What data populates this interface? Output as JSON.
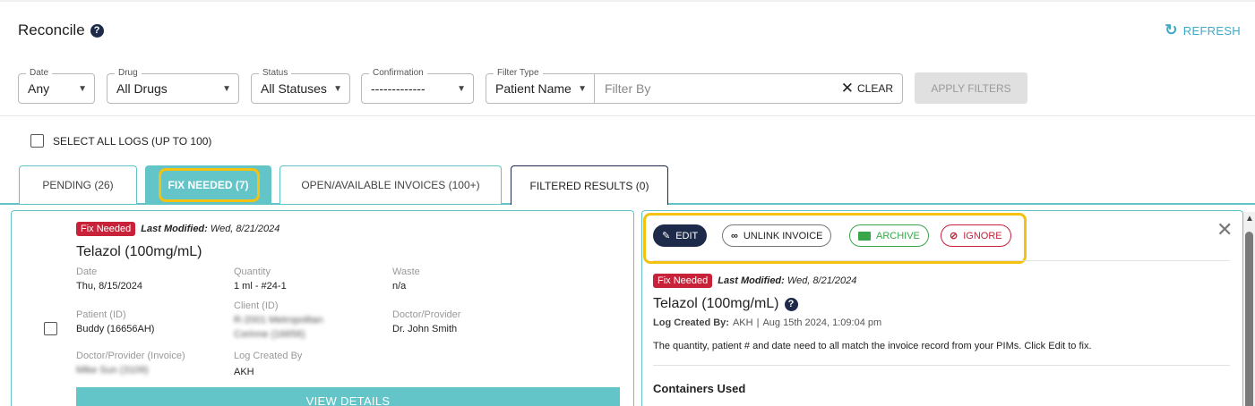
{
  "header": {
    "title": "Reconcile",
    "help_glyph": "?",
    "refresh_label": "REFRESH",
    "refresh_icon": "refresh-icon"
  },
  "filters": {
    "date": {
      "label": "Date",
      "value": "Any"
    },
    "drug": {
      "label": "Drug",
      "value": "All Drugs"
    },
    "status": {
      "label": "Status",
      "value": "All Statuses"
    },
    "confirmation": {
      "label": "Confirmation",
      "value": "-------------"
    },
    "filter_type": {
      "label": "Filter Type",
      "value": "Patient Name"
    },
    "filter_by_placeholder": "Filter By",
    "clear_label": "CLEAR",
    "apply_label": "APPLY FILTERS"
  },
  "select_all_label": "SELECT ALL LOGS (UP TO 100)",
  "tabs": [
    {
      "label": "PENDING (26)"
    },
    {
      "label": "FIX NEEDED (7)"
    },
    {
      "label": "OPEN/AVAILABLE INVOICES (100+)"
    },
    {
      "label": "FILTERED RESULTS (0)"
    }
  ],
  "log_card": {
    "badge": "Fix Needed",
    "modified_label": "Last Modified:",
    "modified_value": "Wed, 8/21/2024",
    "drug": "Telazol (100mg/mL)",
    "date_label": "Date",
    "date_value": "Thu, 8/15/2024",
    "quantity_label": "Quantity",
    "quantity_value": "1 ml - #24-1",
    "waste_label": "Waste",
    "waste_value": "n/a",
    "patient_label": "Patient (ID)",
    "patient_value": "Buddy (16656AH)",
    "client_label": "Client (ID)",
    "client_value_line1": "R-2001 Metropolitan",
    "client_value_line2": "Corinne (16656)",
    "doctor_label": "Doctor/Provider",
    "doctor_value": "Dr. John Smith",
    "doctor_invoice_label": "Doctor/Provider (Invoice)",
    "doctor_invoice_value": "Mike Sun (3109)",
    "log_created_label": "Log Created By",
    "log_created_value": "AKH",
    "view_details_label": "VIEW DETAILS"
  },
  "detail": {
    "actions": {
      "edit": "EDIT",
      "unlink": "UNLINK INVOICE",
      "archive": "ARCHIVE",
      "ignore": "IGNORE"
    },
    "badge": "Fix Needed",
    "modified_label": "Last Modified:",
    "modified_value": "Wed, 8/21/2024",
    "drug": "Telazol (100mg/mL)",
    "log_created_label": "Log Created By:",
    "log_created_value": "AKH",
    "log_created_sep": "|",
    "log_created_time": "Aug 15th 2024, 1:09:04 pm",
    "message": "The quantity, patient # and date need to all match the invoice record from your PIMs. Click Edit to fix.",
    "containers_heading": "Containers Used"
  },
  "colors": {
    "teal": "#63c5c8",
    "navy": "#1d2a4a",
    "red": "#c8223a",
    "green": "#3aa64a",
    "highlight": "#f5c211"
  }
}
